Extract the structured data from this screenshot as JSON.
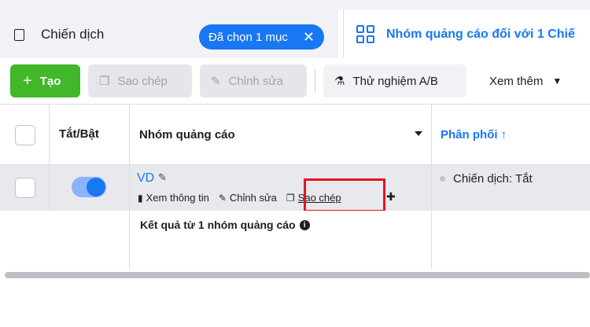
{
  "tabs": {
    "campaign": {
      "label": "Chiến dịch",
      "selected_badge": "Đã chọn 1 mục",
      "clear_icon": "close-icon"
    },
    "adset": {
      "label": "Nhóm quảng cáo đối với 1 Chiế"
    }
  },
  "toolbar": {
    "create_label": "Tạo",
    "copy_label": "Sao chép",
    "edit_label": "Chỉnh sửa",
    "ab_test_label": "Thử nghiệm A/B",
    "more_label": "Xem thêm"
  },
  "table": {
    "headers": {
      "toggle": "Tắt/Bật",
      "name": "Nhóm quảng cáo",
      "delivery": "Phân phối ↑"
    },
    "rows": [
      {
        "name": "VD",
        "on": true,
        "actions": {
          "view": "Xem thông tin",
          "edit": "Chỉnh sửa",
          "copy": "Sao chép"
        },
        "delivery": "Chiến dịch: Tắt"
      }
    ],
    "summary": "Kết quả từ 1 nhóm quảng cáo"
  },
  "colors": {
    "accent": "#1877f2",
    "create": "#42b72a",
    "highlight": "#e4141e"
  }
}
